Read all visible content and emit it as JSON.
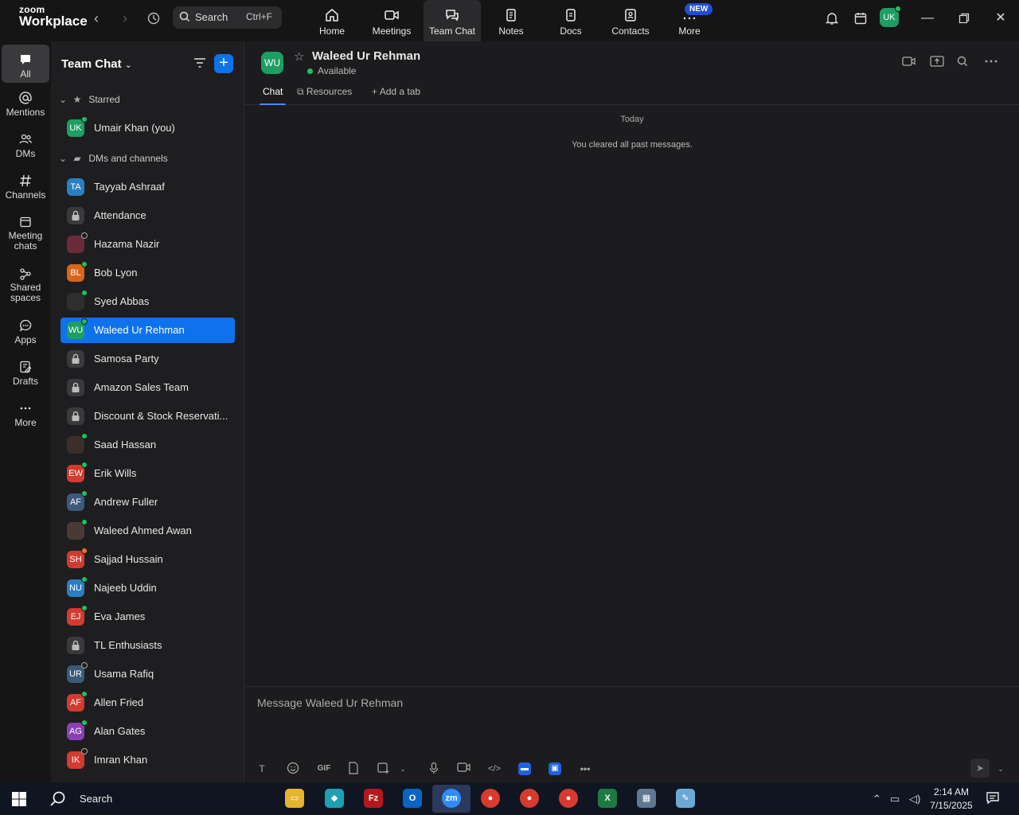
{
  "topbar": {
    "logo_line1": "zoom",
    "logo_line2": "Workplace",
    "search_label": "Search",
    "search_shortcut": "Ctrl+F",
    "tabs": [
      {
        "label": "Home",
        "icon": "home-icon"
      },
      {
        "label": "Meetings",
        "icon": "video-icon"
      },
      {
        "label": "Team Chat",
        "icon": "chat-bubbles-icon"
      },
      {
        "label": "Notes",
        "icon": "notes-icon"
      },
      {
        "label": "Docs",
        "icon": "docs-icon"
      },
      {
        "label": "Contacts",
        "icon": "contacts-icon"
      },
      {
        "label": "More",
        "icon": "more-icon"
      }
    ],
    "new_badge": "NEW",
    "user_initials": "UK"
  },
  "rail": {
    "items": [
      {
        "label": "All",
        "icon": "chat-bubble-icon"
      },
      {
        "label": "Mentions",
        "icon": "at-sign-icon"
      },
      {
        "label": "DMs",
        "icon": "people-icon"
      },
      {
        "label": "Channels",
        "icon": "hash-icon"
      },
      {
        "label": "Meeting chats",
        "icon": "calendar-icon"
      },
      {
        "label": "Shared spaces",
        "icon": "share-nodes-icon"
      },
      {
        "label": "Apps",
        "icon": "apps-bubble-icon"
      },
      {
        "label": "Drafts",
        "icon": "draft-icon"
      },
      {
        "label": "More",
        "icon": "ellipsis-icon"
      }
    ]
  },
  "list": {
    "title": "Team Chat",
    "starred_label": "Starred",
    "dms_label": "DMs and channels",
    "starred": [
      {
        "name": "Umair Khan (you)",
        "initials": "UK",
        "color": "#1e9e62",
        "status": "green"
      }
    ],
    "items": [
      {
        "name": "Tayyab Ashraaf",
        "initials": "TA",
        "color": "#2a7fc1",
        "status": "none"
      },
      {
        "name": "Attendance",
        "initials": "",
        "color": "#3a3a3c",
        "status": "lock"
      },
      {
        "name": "Hazama Nazir",
        "initials": "",
        "color": "#6b2a3a",
        "status": "grey"
      },
      {
        "name": "Bob Lyon",
        "initials": "BL",
        "color": "#d9641a",
        "status": "green"
      },
      {
        "name": "Syed Abbas",
        "initials": "",
        "color": "#2e2e2e",
        "status": "green"
      },
      {
        "name": "Waleed Ur Rehman",
        "initials": "WU",
        "color": "#1e9e62",
        "status": "green",
        "selected": true
      },
      {
        "name": "Samosa Party",
        "initials": "",
        "color": "#3a3a3c",
        "status": "lock"
      },
      {
        "name": "Amazon Sales Team",
        "initials": "",
        "color": "#3a3a3c",
        "status": "lock"
      },
      {
        "name": "Discount & Stock Reservati...",
        "initials": "",
        "color": "#3a3a3c",
        "status": "lock"
      },
      {
        "name": "Saad Hassan",
        "initials": "",
        "color": "#3c2e2a",
        "status": "green"
      },
      {
        "name": "Erik Wills",
        "initials": "EW",
        "color": "#d23b2f",
        "status": "green"
      },
      {
        "name": "Andrew Fuller",
        "initials": "AF",
        "color": "#3c5a7a",
        "status": "green"
      },
      {
        "name": "Waleed Ahmed Awan",
        "initials": "",
        "color": "#4a3a36",
        "status": "green"
      },
      {
        "name": "Sajjad Hussain",
        "initials": "SH",
        "color": "#d23b2f",
        "status": "orange"
      },
      {
        "name": "Najeeb Uddin",
        "initials": "NU",
        "color": "#2a7fc1",
        "status": "green"
      },
      {
        "name": "Eva James",
        "initials": "EJ",
        "color": "#d23b2f",
        "status": "green"
      },
      {
        "name": "TL Enthusiasts",
        "initials": "",
        "color": "#3a3a3c",
        "status": "lock"
      },
      {
        "name": "Usama Rafiq",
        "initials": "UR",
        "color": "#3c5a7a",
        "status": "grey"
      },
      {
        "name": "Allen Fried",
        "initials": "AF",
        "color": "#d23b2f",
        "status": "green"
      },
      {
        "name": "Alan Gates",
        "initials": "AG",
        "color": "#8a3fb5",
        "status": "green"
      },
      {
        "name": "Imran Khan",
        "initials": "IK",
        "color": "#d23b2f",
        "status": "grey"
      }
    ]
  },
  "chat": {
    "initials": "WU",
    "name": "Waleed Ur Rehman",
    "status": "Available",
    "tabs": [
      "Chat",
      "Resources",
      "Add a tab"
    ],
    "date_divider": "Today",
    "system_message": "You cleared all past messages.",
    "composer_placeholder": "Message Waleed Ur Rehman",
    "gif_label": "GIF"
  },
  "taskbar": {
    "search_label": "Search",
    "time": "2:14 AM",
    "date": "7/15/2025"
  }
}
